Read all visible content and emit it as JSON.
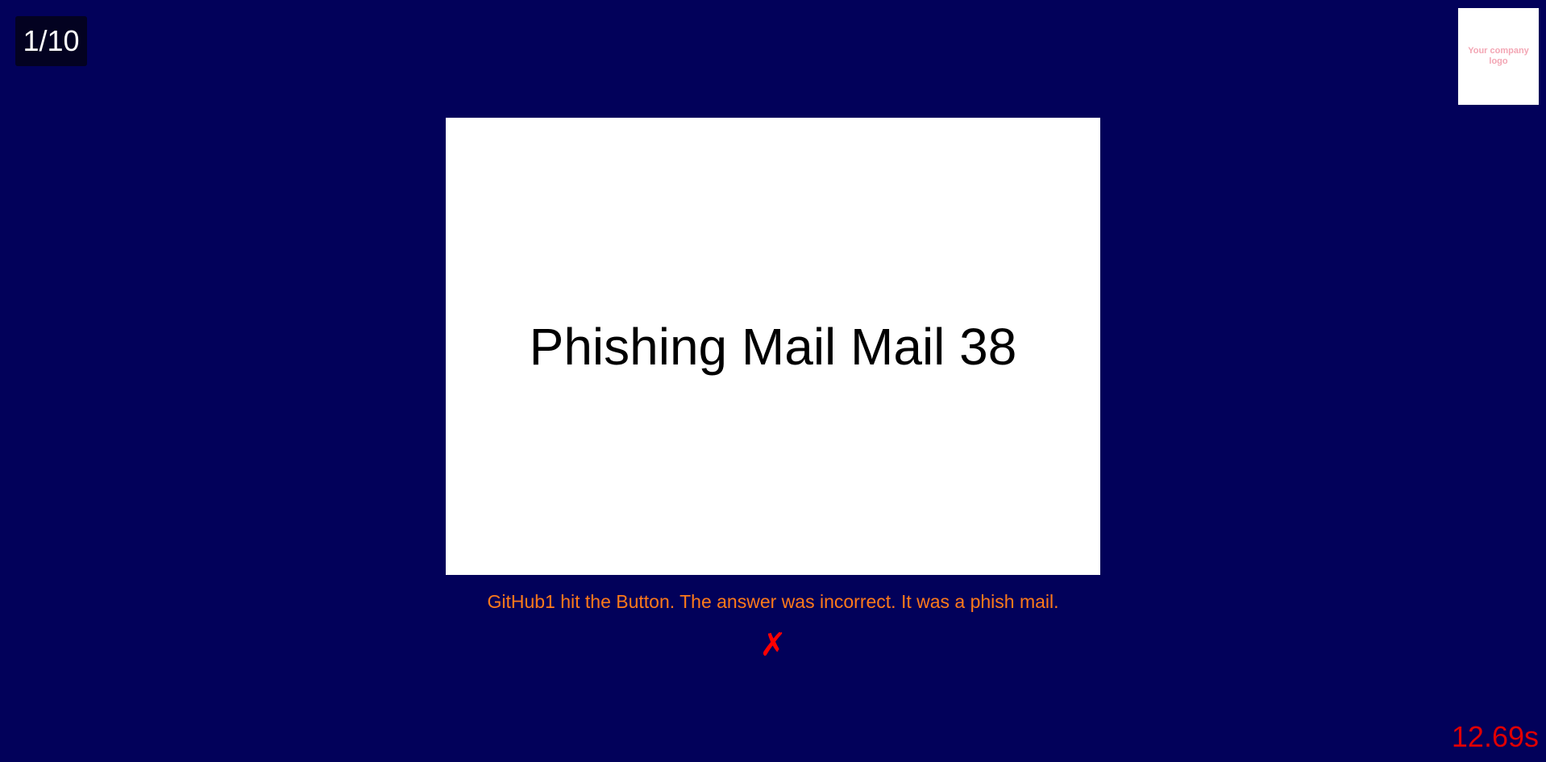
{
  "progress": {
    "label": "1/10",
    "current": 1,
    "total": 10
  },
  "logo": {
    "text": "Your company logo"
  },
  "mail": {
    "title": "Phishing Mail Mail 38"
  },
  "feedback": {
    "message": "GitHub1 hit the Button. The answer was incorrect. It was a phish mail.",
    "result_icon": "cross-icon",
    "result_glyph": "✗"
  },
  "timer": {
    "value": "12.69s"
  },
  "colors": {
    "background": "#02015a",
    "counter_background": "#030221",
    "feedback_text": "#ff7a1a",
    "error_red": "#ff0000",
    "logo_placeholder_text": "#f3a6b4"
  }
}
